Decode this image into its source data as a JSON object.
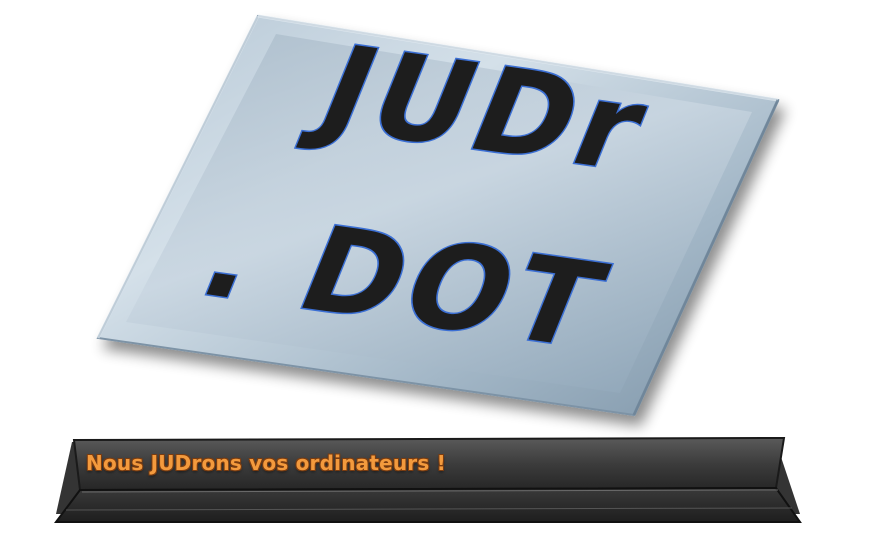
{
  "logo": {
    "line1": "JUDr",
    "line2": ". DOT"
  },
  "banner": {
    "slogan": "Nous JUDrons vos ordinateurs !"
  },
  "colors": {
    "plate_light": "#c3d2dd",
    "plate_mid": "#9cb0c1",
    "plate_dark": "#6f879c",
    "letter_fill": "#1d1d1d",
    "letter_outline": "#3b6fd4",
    "banner_dark": "#2f2f2f",
    "banner_mid": "#4a4a4a",
    "slogan_color": "#f39a3d"
  }
}
